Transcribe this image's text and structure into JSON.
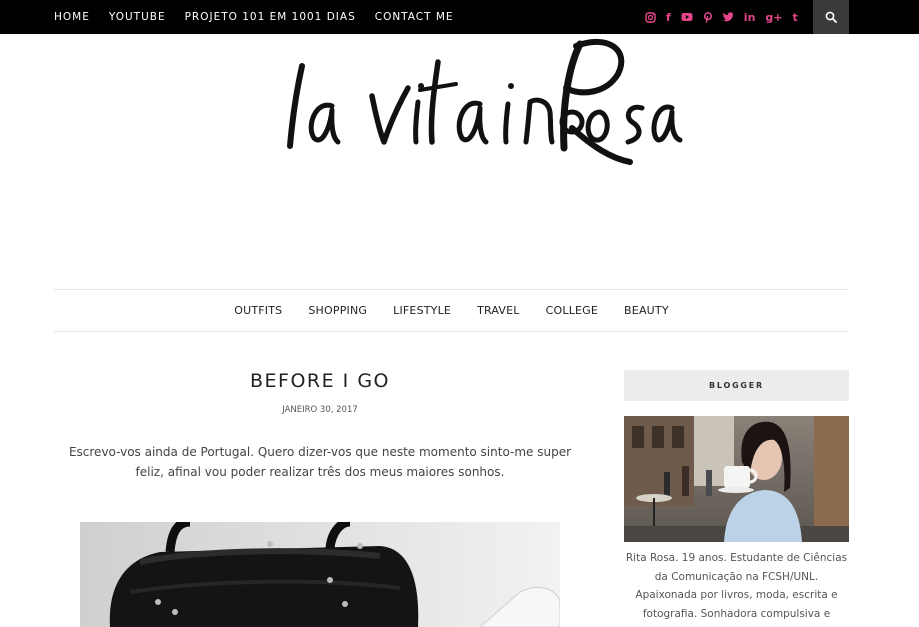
{
  "top_nav": {
    "items": [
      "HOME",
      "YOUTUBE",
      "PROJETO 101 EM 1001 DIAS",
      "CONTACT ME"
    ]
  },
  "social_icons": [
    "instagram-icon",
    "facebook-icon",
    "youtube-icon",
    "pinterest-icon",
    "twitter-icon",
    "linkedin-icon",
    "google-plus-icon",
    "tumblr-icon"
  ],
  "colors": {
    "topbar": "#000000",
    "social_accent": "#e5468a",
    "search_bg": "#3a3a3a",
    "widget_head_bg": "#ececec"
  },
  "logo": {
    "text": "la vita in Rosa"
  },
  "categories": [
    "OUTFITS",
    "SHOPPING",
    "LIFESTYLE",
    "TRAVEL",
    "COLLEGE",
    "BEAUTY"
  ],
  "post": {
    "title": "BEFORE I GO",
    "date": "JANEIRO 30, 2017",
    "excerpt": "Escrevo-vos ainda de Portugal. Quero dizer-vos que neste momento sinto-me super feliz, afinal vou poder realizar três dos meus maiores sonhos."
  },
  "sidebar": {
    "widget_title": "BLOGGER",
    "about": "Rita Rosa. 19 anos. Estudante de Ciências da Comunicação na FCSH/UNL. Apaixonada por livros, moda, escrita e fotografia. Sonhadora compulsiva e teimosa por natureza."
  }
}
